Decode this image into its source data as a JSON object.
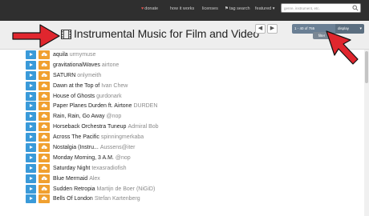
{
  "nav": {
    "donate": "donate",
    "how_it_works": "how it works",
    "licenses": "licenses",
    "tag_search": "tag search",
    "featured": "featured",
    "search_placeholder": "genre, instrument, etc."
  },
  "page": {
    "title": "Instrumental Music for Film and Video"
  },
  "pager": {
    "prev_label": "◀",
    "next_label": "▶",
    "range_text": "1 - 40 of 755",
    "display_label": "display",
    "filter_label": "filter"
  },
  "tracks": [
    {
      "title": "aquila",
      "artist": "urmymuse"
    },
    {
      "title": "gravitationalWaves",
      "artist": "airtone"
    },
    {
      "title": "SATURN",
      "artist": "onlymeith"
    },
    {
      "title": "Dawn at the Top of",
      "artist": "Ivan Chew"
    },
    {
      "title": "House of Ghosts",
      "artist": "gurdonark"
    },
    {
      "title": "Paper Planes Durden ft. Airtone",
      "artist": "DURDEN"
    },
    {
      "title": "Rain, Rain, Go Away",
      "artist": "@nop"
    },
    {
      "title": "Horseback Orchestra Tuneup",
      "artist": "Admiral Bob"
    },
    {
      "title": "Across The Pacific",
      "artist": "spinningmerkaba"
    },
    {
      "title": "Nostalgia (Instru...",
      "artist": "Aussens@iter"
    },
    {
      "title": "Monday Morning, 3 A.M.",
      "artist": "@nop"
    },
    {
      "title": "Saturday Night",
      "artist": "texasradiofish"
    },
    {
      "title": "Blue Mermaid",
      "artist": "Alex"
    },
    {
      "title": "Sudden Retropia",
      "artist": "Martijn de Boer (NiGiD)"
    },
    {
      "title": "Bells Of London",
      "artist": "Stefan Kartenberg"
    }
  ],
  "colors": {
    "nav_bg": "#2f2f2f",
    "play": "#3a9ad9",
    "download": "#f0a030",
    "arrow": "#e0262e"
  }
}
